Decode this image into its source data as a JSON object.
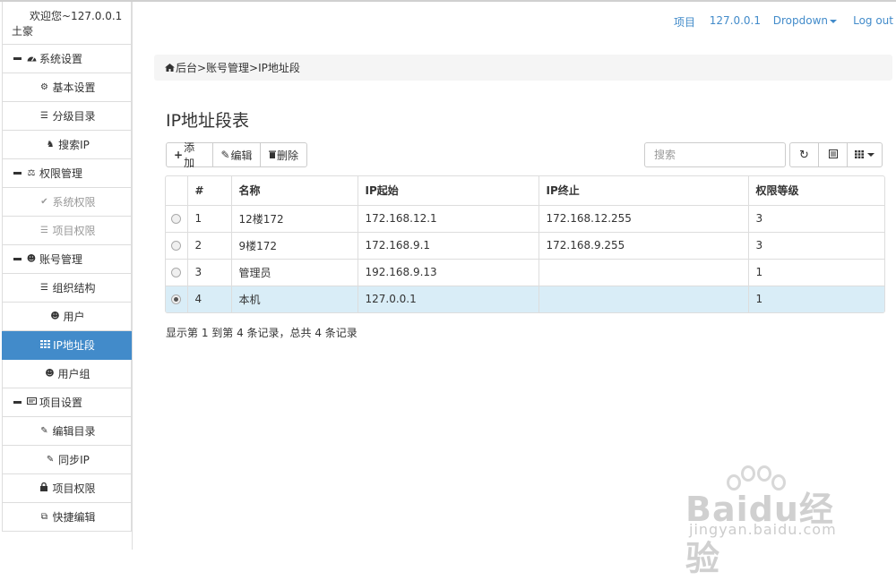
{
  "sidebar": {
    "welcome": "欢迎您~127.0.0.1土豪",
    "items": [
      {
        "label": "系统设置",
        "type": "group",
        "icon": "dashboard-icon"
      },
      {
        "label": "基本设置",
        "type": "child",
        "icon": "gear-icon"
      },
      {
        "label": "分级目录",
        "type": "child",
        "icon": "list-icon"
      },
      {
        "label": "搜索IP",
        "type": "child",
        "icon": "tower-icon"
      },
      {
        "label": "权限管理",
        "type": "group",
        "icon": "scale-icon"
      },
      {
        "label": "系统权限",
        "type": "child",
        "icon": "check-circle-icon",
        "disabled": true
      },
      {
        "label": "项目权限",
        "type": "child",
        "icon": "menu-icon",
        "disabled": true
      },
      {
        "label": "账号管理",
        "type": "group",
        "icon": "users-icon"
      },
      {
        "label": "组织结构",
        "type": "child",
        "icon": "list-icon"
      },
      {
        "label": "用户",
        "type": "child",
        "icon": "users-icon"
      },
      {
        "label": "IP地址段",
        "type": "child",
        "icon": "grid-icon",
        "active": true
      },
      {
        "label": "用户组",
        "type": "child",
        "icon": "users-icon"
      },
      {
        "label": "项目设置",
        "type": "group",
        "icon": "card-icon"
      },
      {
        "label": "编辑目录",
        "type": "child",
        "icon": "edit-icon"
      },
      {
        "label": "同步IP",
        "type": "child",
        "icon": "edit-icon"
      },
      {
        "label": "项目权限",
        "type": "child",
        "icon": "lock-icon"
      },
      {
        "label": "快捷编辑",
        "type": "child",
        "icon": "copy-icon"
      }
    ]
  },
  "topnav": {
    "project": "项目",
    "ip": "127.0.0.1",
    "dropdown": "Dropdown",
    "logout": "Log out"
  },
  "breadcrumb": {
    "text": "后台>账号管理>IP地址段"
  },
  "page": {
    "title": "IP地址段表"
  },
  "toolbar": {
    "add": "添加",
    "edit": "编辑",
    "delete": "删除",
    "search_placeholder": "搜索"
  },
  "table": {
    "columns": [
      "#",
      "名称",
      "IP起始",
      "IP终止",
      "权限等级"
    ],
    "rows": [
      {
        "id": "1",
        "name": "12楼172",
        "ip_start": "172.168.12.1",
        "ip_end": "172.168.12.255",
        "level": "3",
        "selected": false
      },
      {
        "id": "2",
        "name": "9楼172",
        "ip_start": "172.168.9.1",
        "ip_end": "172.168.9.255",
        "level": "3",
        "selected": false
      },
      {
        "id": "3",
        "name": "管理员",
        "ip_start": "192.168.9.13",
        "ip_end": "",
        "level": "1",
        "selected": false
      },
      {
        "id": "4",
        "name": "本机",
        "ip_start": "127.0.0.1",
        "ip_end": "",
        "level": "1",
        "selected": true
      }
    ]
  },
  "summary": "显示第 1 到第 4 条记录，总共 4 条记录",
  "watermark": {
    "logo": "Baidu经验",
    "url": "jingyan.baidu.com"
  },
  "colors": {
    "accent": "#428bca",
    "selected_row": "#d9edf7",
    "breadcrumb_bg": "#f5f5f5"
  }
}
